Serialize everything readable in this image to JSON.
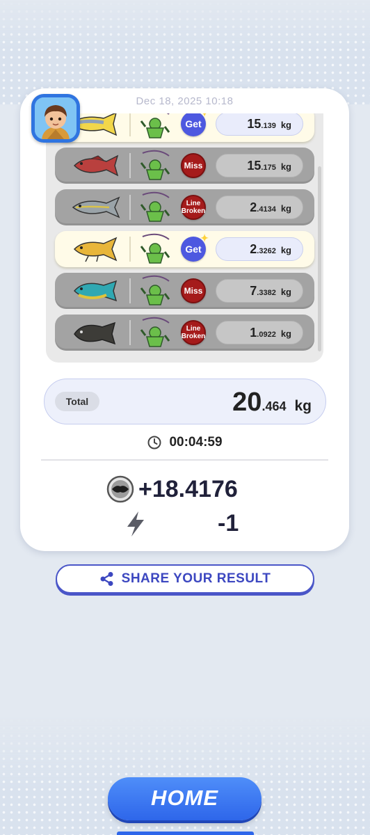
{
  "result": {
    "date": "Dec 18, 2025 10:18",
    "catches": [
      {
        "status": "Get",
        "status_type": "get",
        "weight_int": "15",
        "weight_dec": ".139",
        "unit": "kg",
        "fish_color": "#f2d74a"
      },
      {
        "status": "Miss",
        "status_type": "miss",
        "weight_int": "15",
        "weight_dec": ".175",
        "unit": "kg",
        "fish_color": "#b9403e"
      },
      {
        "status": "Line Broken",
        "status_type": "line",
        "weight_int": "2",
        "weight_dec": ".4134",
        "unit": "kg",
        "fish_color": "#9aa3a8"
      },
      {
        "status": "Get",
        "status_type": "get",
        "weight_int": "2",
        "weight_dec": ".3262",
        "unit": "kg",
        "fish_color": "#e8b63a"
      },
      {
        "status": "Miss",
        "status_type": "miss",
        "weight_int": "7",
        "weight_dec": ".3382",
        "unit": "kg",
        "fish_color": "#30a8b2"
      },
      {
        "status": "Line Broken",
        "status_type": "line",
        "weight_int": "1",
        "weight_dec": ".0922",
        "unit": "kg",
        "fish_color": "#3d3c38"
      }
    ],
    "status_get_line1": "Get",
    "status_miss_line1": "Miss",
    "status_line_line1": "Line",
    "status_line_line2": "Broken",
    "total_label": "Total",
    "total_int": "20",
    "total_dec": ".464",
    "total_unit": "kg",
    "time": "00:04:59",
    "reward": "+18.4176",
    "energy": "-1"
  },
  "actions": {
    "share_label": "SHARE YOUR RESULT",
    "home_label": "HOME"
  },
  "icons": {
    "clock": "clock-icon",
    "share": "share-icon",
    "coin": "token-coin-icon",
    "energy": "lightning-icon"
  },
  "colors": {
    "accent": "#4a56c8",
    "home_button": "#2e66ea",
    "get_badge": "#4d58e0",
    "miss_badge": "#a51b1b"
  }
}
